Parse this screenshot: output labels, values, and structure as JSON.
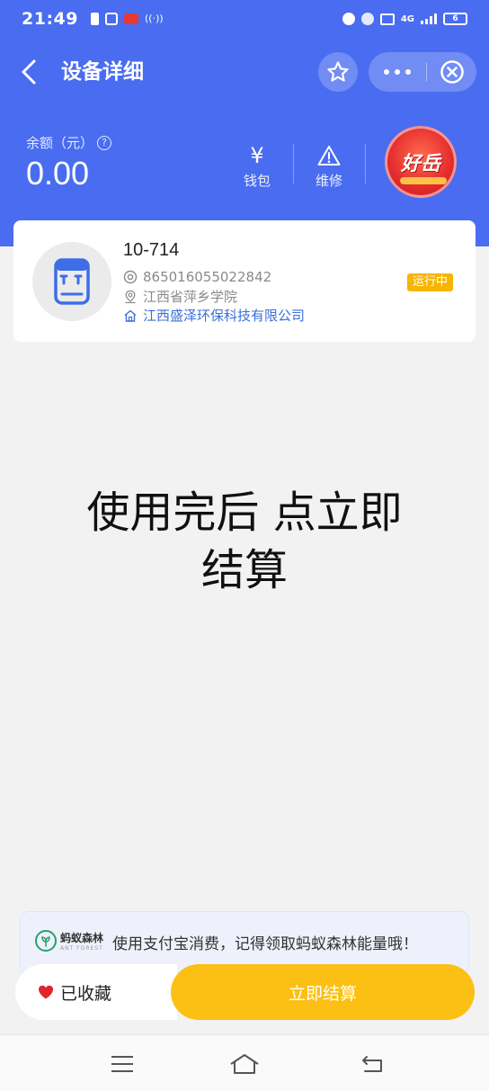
{
  "status_bar": {
    "time": "21:49",
    "network": "4G",
    "battery": "6"
  },
  "header": {
    "title": "设备详细",
    "balance_label": "余额（元）",
    "balance_value": "0.00",
    "help_glyph": "?",
    "actions": [
      {
        "label": "钱包",
        "glyph": "¥",
        "icon": "wallet-icon"
      },
      {
        "label": "维修",
        "icon": "warning-triangle-icon"
      }
    ],
    "promo_text": "好岳",
    "colors": {
      "primary": "#4a6cf0",
      "accent": "#fcc014"
    }
  },
  "device": {
    "name": "10-714",
    "serial": "865016055022842",
    "location": "江西省萍乡学院",
    "company": "江西盛泽环保科技有限公司",
    "status": "运行中",
    "status_color": "#f7b500"
  },
  "overlay": {
    "line1": "使用完后 点立即",
    "line2": "结算"
  },
  "forest": {
    "logo_name": "蚂蚁森林",
    "logo_sub": "ANT FOREST",
    "text": "使用支付宝消费，记得领取蚂蚁森林能量哦！"
  },
  "bottom": {
    "favorite_label": "已收藏",
    "settle_label": "立即结算"
  },
  "icons": {
    "nav": [
      "menu-icon",
      "home-icon",
      "back-nav-icon"
    ]
  }
}
